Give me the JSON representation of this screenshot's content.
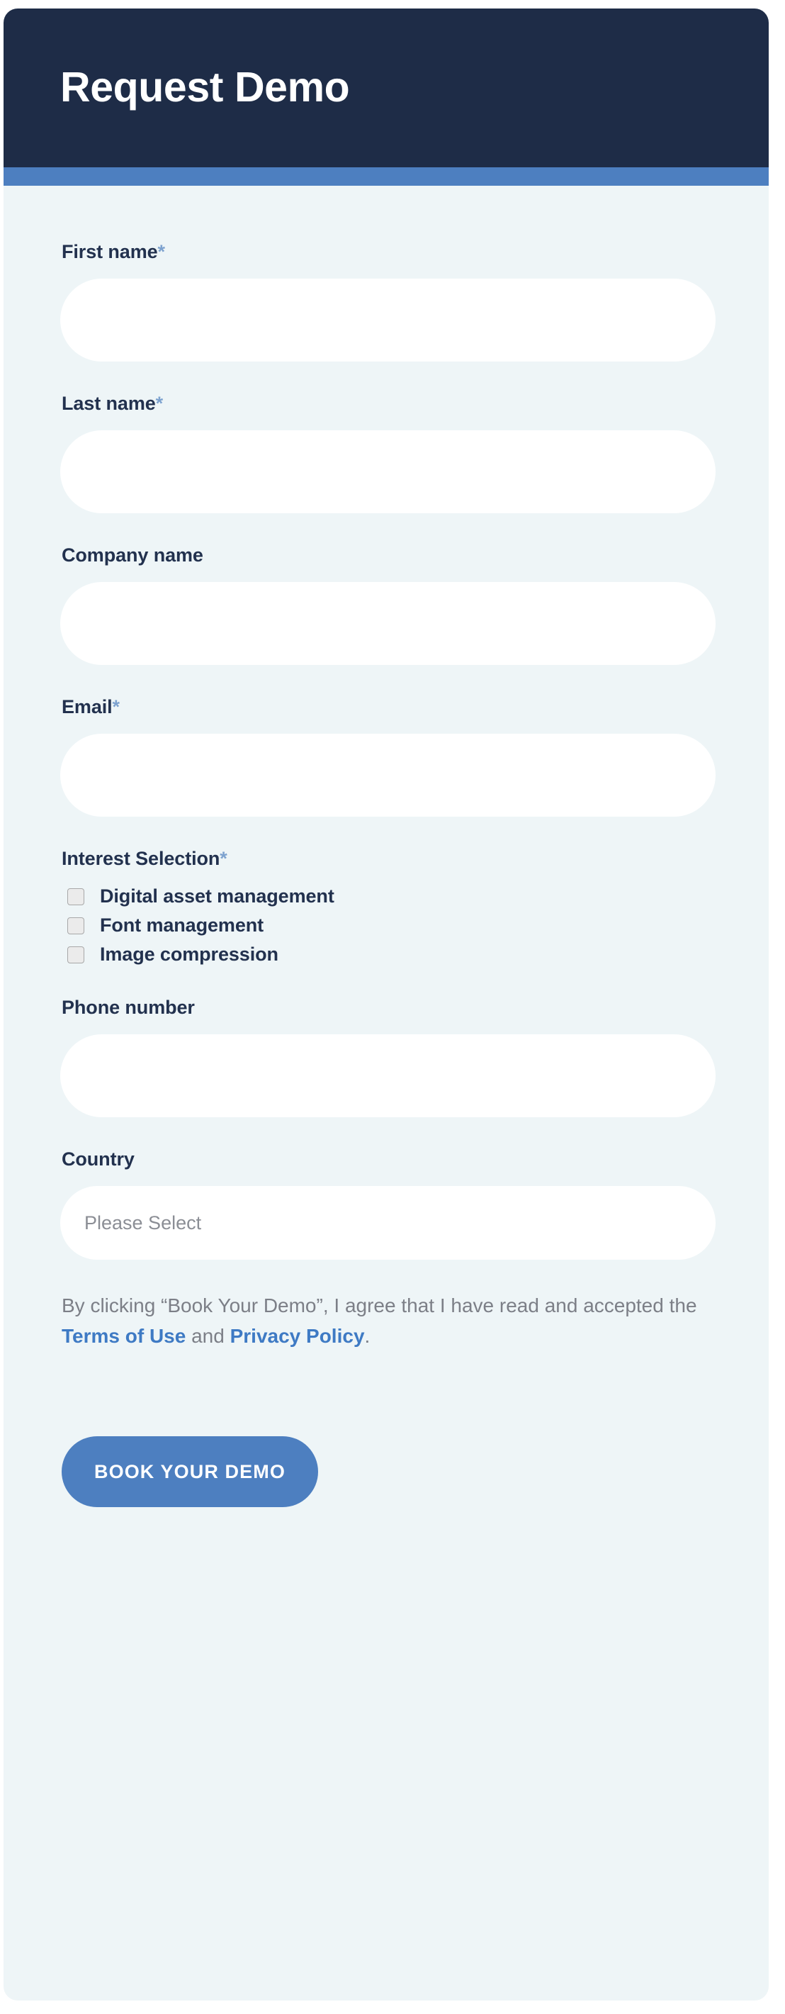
{
  "header": {
    "title": "Request Demo"
  },
  "colors": {
    "header_background": "#1e2c47",
    "accent_bar": "#4d7fc0",
    "panel_background": "#eef5f7",
    "label_text": "#22314e",
    "required_star": "#7da2cf",
    "link_blue": "#3e7ac4",
    "legal_text": "#7c7f87",
    "button_background": "#4d7fc0",
    "input_background": "#ffffff"
  },
  "form": {
    "fields": [
      {
        "name": "first-name",
        "label": "First name",
        "required_marker": "*",
        "value": "",
        "placeholder": ""
      },
      {
        "name": "last-name",
        "label": "Last name",
        "required_marker": "*",
        "value": "",
        "placeholder": ""
      },
      {
        "name": "company-name",
        "label": "Company name",
        "required_marker": "",
        "value": "",
        "placeholder": ""
      },
      {
        "name": "email",
        "label": "Email",
        "required_marker": "*",
        "value": "",
        "placeholder": ""
      }
    ],
    "interest_selection": {
      "label": "Interest Selection",
      "required_marker": "*",
      "options": [
        {
          "label": "Digital asset management",
          "checked": false
        },
        {
          "label": "Font management",
          "checked": false
        },
        {
          "label": "Image compression",
          "checked": false
        }
      ]
    },
    "phone": {
      "label": "Phone number",
      "required_marker": "",
      "value": "",
      "placeholder": ""
    },
    "country": {
      "label": "Country",
      "required_marker": "",
      "selected_value": "Please Select"
    },
    "legal": {
      "part1": "By clicking “Book Your Demo”, I agree that I have read and accepted the ",
      "terms_link": "Terms of Use",
      "part2": " and ",
      "privacy_link": "Privacy Policy",
      "part3": "."
    },
    "submit": {
      "label": "BOOK YOUR DEMO"
    }
  }
}
